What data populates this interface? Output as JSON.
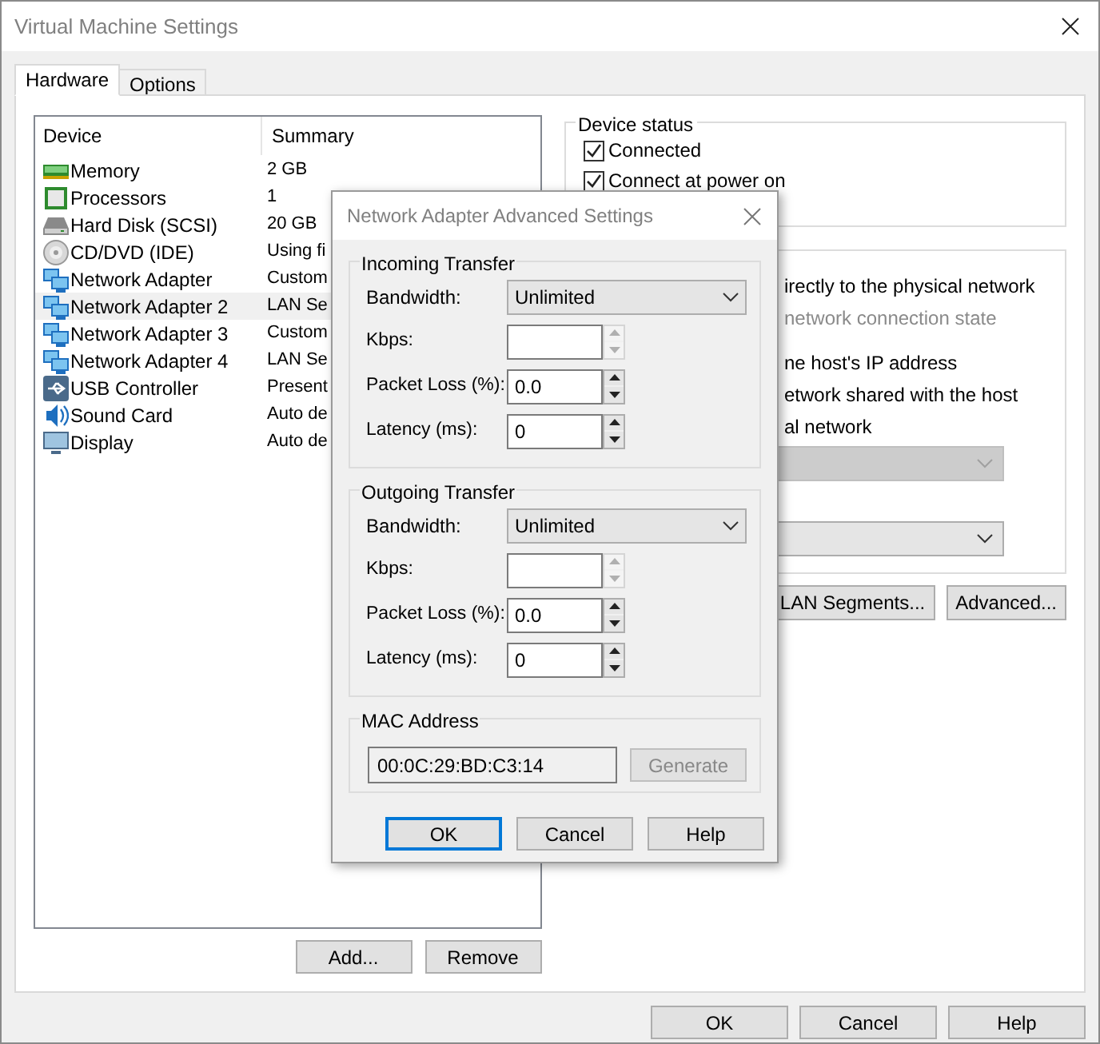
{
  "window": {
    "title": "Virtual Machine Settings"
  },
  "tabs": [
    {
      "label": "Hardware",
      "selected": true
    },
    {
      "label": "Options",
      "selected": false
    }
  ],
  "device_list": {
    "columns": [
      "Device",
      "Summary"
    ],
    "rows": [
      {
        "kind": "memory",
        "device": "Memory",
        "summary": "2 GB",
        "selected": false
      },
      {
        "kind": "processor",
        "device": "Processors",
        "summary": "1",
        "selected": false
      },
      {
        "kind": "disk",
        "device": "Hard Disk (SCSI)",
        "summary": "20 GB",
        "selected": false
      },
      {
        "kind": "cd",
        "device": "CD/DVD (IDE)",
        "summary": "Using fi",
        "selected": false
      },
      {
        "kind": "network",
        "device": "Network Adapter",
        "summary": "Custom",
        "selected": false
      },
      {
        "kind": "network",
        "device": "Network Adapter 2",
        "summary": "LAN Se",
        "selected": true
      },
      {
        "kind": "network",
        "device": "Network Adapter 3",
        "summary": "Custom",
        "selected": false
      },
      {
        "kind": "network",
        "device": "Network Adapter 4",
        "summary": "LAN Se",
        "selected": false
      },
      {
        "kind": "usb",
        "device": "USB Controller",
        "summary": "Present",
        "selected": false
      },
      {
        "kind": "sound",
        "device": "Sound Card",
        "summary": "Auto de",
        "selected": false
      },
      {
        "kind": "display",
        "device": "Display",
        "summary": "Auto de",
        "selected": false
      }
    ]
  },
  "list_buttons": [
    "Add...",
    "Remove"
  ],
  "device_status": {
    "title": "Device status",
    "options": [
      {
        "label": "Connected",
        "checked": true
      },
      {
        "label": "Connect at power on",
        "checked": true
      }
    ]
  },
  "network_connection": {
    "lines": [
      {
        "text": "irectly to the physical network",
        "disabled": false
      },
      {
        "text": "network connection state",
        "disabled": true
      },
      {
        "text": "ne host's IP address",
        "disabled": false
      },
      {
        "text": "etwork shared with the host",
        "disabled": false
      },
      {
        "text": "al network",
        "disabled": false
      }
    ],
    "dropdowns": [
      {
        "disabled": true
      },
      {
        "disabled": false
      }
    ]
  },
  "network_buttons": [
    "LAN Segments...",
    "Advanced..."
  ],
  "dialog": {
    "title": "Network Adapter Advanced Settings",
    "transfers": [
      {
        "title": "Incoming Transfer",
        "bandwidth_label": "Bandwidth:",
        "bandwidth": "Unlimited",
        "fields": [
          {
            "label": "Kbps:",
            "disabled": true
          },
          {
            "label": "Packet Loss (%):",
            "value": "0.0",
            "disabled": false
          },
          {
            "label": "Latency (ms):",
            "value": "0",
            "disabled": false
          }
        ]
      },
      {
        "title": "Outgoing Transfer",
        "bandwidth_label": "Bandwidth:",
        "bandwidth": "Unlimited",
        "fields": [
          {
            "label": "Kbps:",
            "disabled": true
          },
          {
            "label": "Packet Loss (%):",
            "value": "0.0",
            "disabled": false
          },
          {
            "label": "Latency (ms):",
            "value": "0",
            "disabled": false
          }
        ]
      }
    ],
    "mac": {
      "title": "MAC Address",
      "value": "00:0C:29:BD:C3:14",
      "button": {
        "label": "Generate",
        "disabled": true
      }
    },
    "buttons": [
      {
        "label": "OK",
        "default": true
      },
      {
        "label": "Cancel",
        "default": false
      },
      {
        "label": "Help",
        "default": false
      }
    ]
  },
  "buttons": [
    "OK",
    "Cancel",
    "Help"
  ]
}
